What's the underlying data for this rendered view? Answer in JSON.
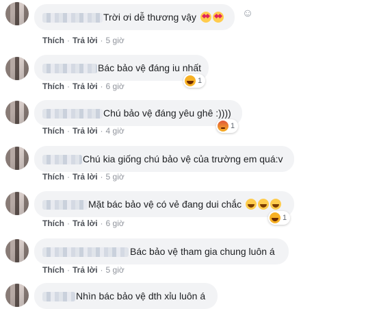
{
  "actions": {
    "like": "Thích",
    "reply": "Trả lời",
    "separator": "·"
  },
  "comments": [
    {
      "text": "Trời ơi dễ thương vậy",
      "emoji_after": [
        "smiling-face-with-hearts-icon",
        "smiling-face-with-hearts-icon"
      ],
      "time": "5 giờ"
    },
    {
      "text": "Bác bảo vệ đáng iu nhất",
      "time": "6 giờ",
      "reaction": {
        "icon": "haha-icon",
        "count": "1"
      }
    },
    {
      "text": "Chú bảo vệ đáng yêu ghê :))))",
      "time": "4 giờ",
      "reaction": {
        "icon": "angry-icon",
        "count": "1"
      }
    },
    {
      "text": "Chú kia giống chú bảo vệ của trường em quá:v",
      "time": "5 giờ"
    },
    {
      "text": "Mặt bác bảo vệ có vẻ đang dui chắc",
      "emoji_after": [
        "laughing-face-icon",
        "laughing-face-icon",
        "laughing-face-icon"
      ],
      "time": "6 giờ",
      "reaction": {
        "icon": "haha-icon",
        "count": "1"
      }
    },
    {
      "text": "Bác bảo vệ tham gia chung luôn á",
      "time": "5 giờ"
    },
    {
      "text": "Nhìn bác bảo vệ dth xỉu luôn á"
    }
  ]
}
